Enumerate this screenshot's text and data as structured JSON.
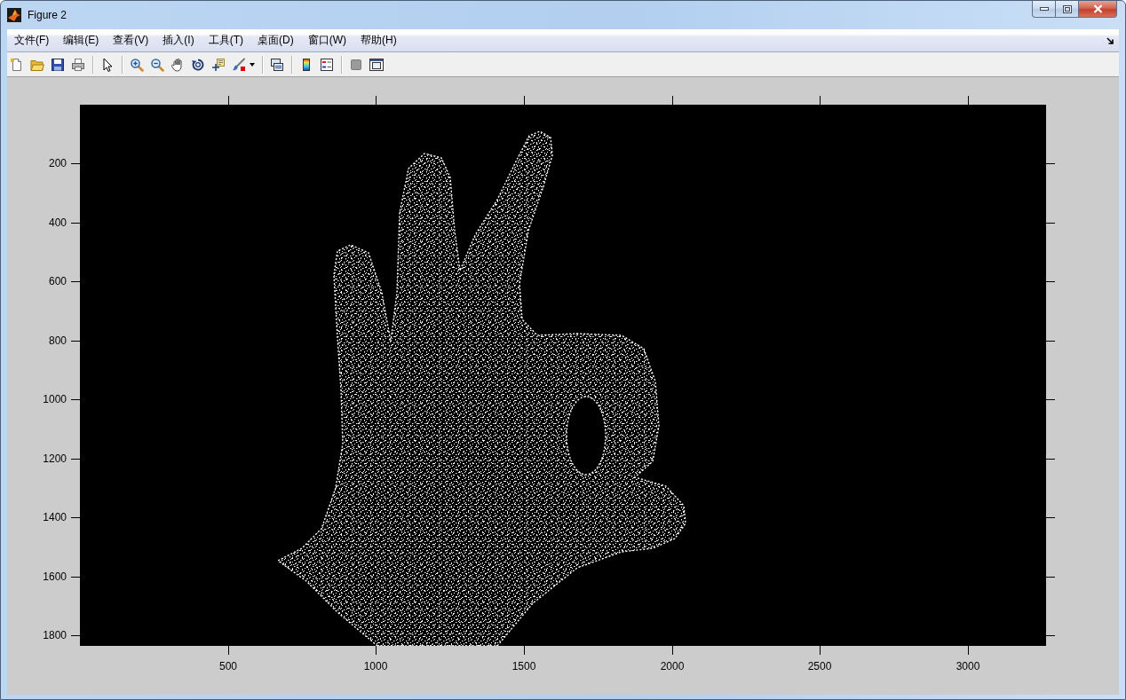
{
  "window": {
    "title": "Figure 2"
  },
  "menus": [
    "文件(F)",
    "编辑(E)",
    "查看(V)",
    "插入(I)",
    "工具(T)",
    "桌面(D)",
    "窗口(W)",
    "帮助(H)"
  ],
  "axes": {
    "xtick_labels": [
      "500",
      "1000",
      "1500",
      "2000",
      "2500",
      "3000"
    ],
    "ytick_labels": [
      "200",
      "400",
      "600",
      "800",
      "1000",
      "1200",
      "1400",
      "1600",
      "1800"
    ]
  }
}
